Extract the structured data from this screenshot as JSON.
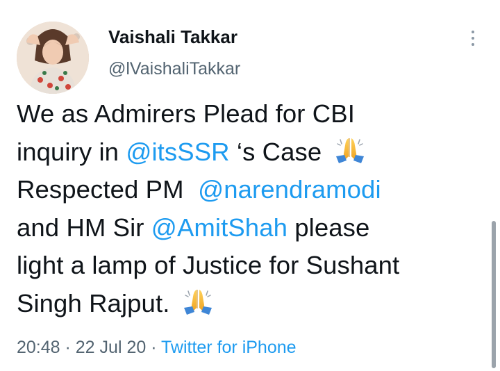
{
  "tweet": {
    "author": {
      "display_name": "Vaishali Takkar",
      "handle": "@lVaishaliTakkar"
    },
    "text_lines": [
      [
        {
          "t": "We as Admirers Plead for CBI",
          "k": "text"
        }
      ],
      [
        {
          "t": "inquiry in ",
          "k": "text"
        },
        {
          "t": "@itsSSR",
          "k": "mention"
        },
        {
          "t": " ‘s Case ",
          "k": "text"
        },
        {
          "t": "folded-hands",
          "k": "emoji"
        }
      ],
      [
        {
          "t": "Respected PM  ",
          "k": "text"
        },
        {
          "t": "@narendramodi",
          "k": "mention"
        }
      ],
      [
        {
          "t": "and HM Sir ",
          "k": "text"
        },
        {
          "t": "@AmitShah",
          "k": "mention"
        },
        {
          "t": " please",
          "k": "text"
        }
      ],
      [
        {
          "t": "light a lamp of Justice for Sushant",
          "k": "text"
        }
      ],
      [
        {
          "t": "Singh Rajput. ",
          "k": "text"
        },
        {
          "t": "folded-hands",
          "k": "emoji"
        }
      ]
    ],
    "meta": {
      "time": "20:48",
      "separator": " · ",
      "date": "22 Jul 20",
      "source": "Twitter for iPhone"
    },
    "colors": {
      "text": "#0f1419",
      "secondary": "#536471",
      "link": "#1d9bf0"
    },
    "icons": {
      "more": "more-vertical-icon",
      "emoji": "folded-hands-emoji"
    }
  }
}
